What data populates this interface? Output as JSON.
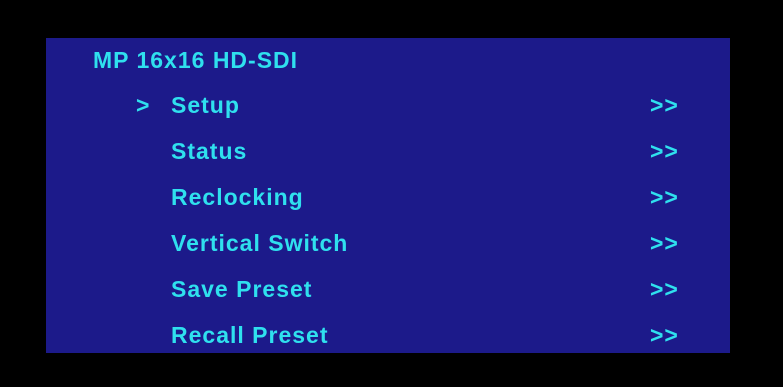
{
  "title": "MP 16x16 HD-SDI",
  "cursor": ">",
  "menu": {
    "selected_index": 0,
    "items": [
      {
        "label": "Setup",
        "arrow": ">>"
      },
      {
        "label": "Status",
        "arrow": ">>"
      },
      {
        "label": "Reclocking",
        "arrow": ">>"
      },
      {
        "label": "Vertical Switch",
        "arrow": ">>"
      },
      {
        "label": "Save Preset",
        "arrow": ">>"
      },
      {
        "label": "Recall Preset",
        "arrow": ">>"
      }
    ]
  },
  "colors": {
    "background": "#000000",
    "panel": "#1c1a8a",
    "text": "#2fe0ee"
  }
}
